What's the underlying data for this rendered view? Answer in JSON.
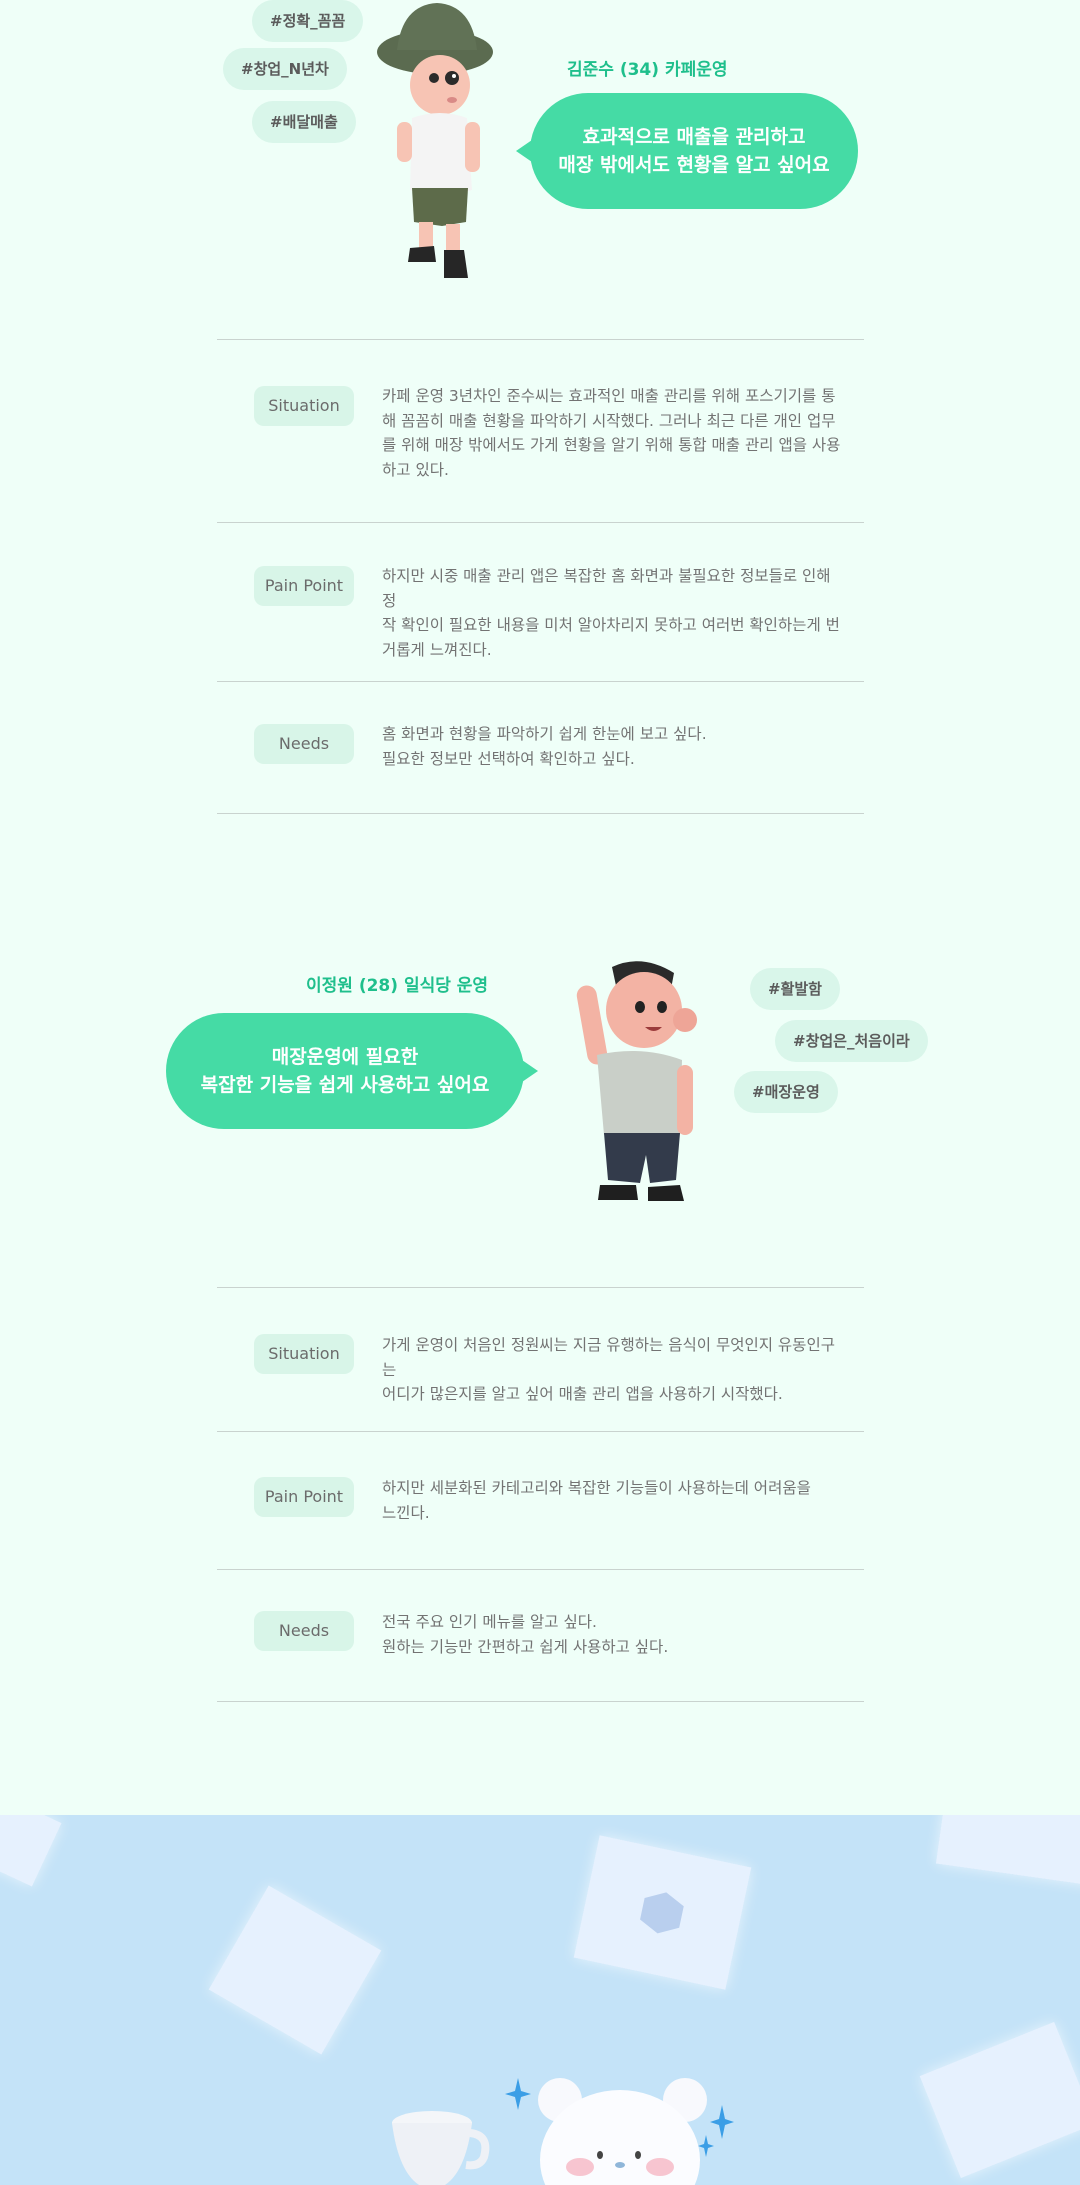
{
  "persona1": {
    "name": "김준수 (34) 카페운영",
    "tags": [
      "#정확_꼼꼼",
      "#창업_N년차",
      "#배달매출"
    ],
    "quote": [
      "효과적으로 매출을 관리하고",
      "매장 밖에서도 현황을 알고 싶어요"
    ],
    "rows": [
      {
        "label": "Situation",
        "text": [
          "카페 운영 3년차인 준수씨는 효과적인 매출 관리를 위해 포스기기를 통",
          "해 꼼꼼히 매출 현황을 파악하기 시작했다. 그러나 최근 다른 개인 업무",
          "를 위해 매장 밖에서도 가게 현황을 알기 위해 통합 매출 관리 앱을 사용",
          "하고 있다."
        ]
      },
      {
        "label": "Pain Point",
        "text": [
          "하지만 시중 매출 관리 앱은 복잡한 홈 화면과 불필요한 정보들로 인해 정",
          "작 확인이 필요한 내용을 미처 알아차리지 못하고 여러번 확인하는게 번",
          "거롭게 느껴진다."
        ]
      },
      {
        "label": "Needs",
        "text": [
          "홈 화면과 현황을 파악하기 쉽게 한눈에 보고 싶다.",
          "필요한 정보만 선택하여 확인하고 싶다."
        ]
      }
    ]
  },
  "persona2": {
    "name": "이정원 (28) 일식당 운영",
    "tags": [
      "#활발함",
      "#창업은_처음이라",
      "#매장운영"
    ],
    "quote": [
      "매장운영에 필요한",
      "복잡한 기능을 쉽게 사용하고 싶어요"
    ],
    "rows": [
      {
        "label": "Situation",
        "text": [
          "가게 운영이 처음인 정원씨는 지금 유행하는 음식이 무엇인지 유동인구는",
          "어디가 많은지를 알고 싶어 매출 관리 앱을 사용하기 시작했다."
        ]
      },
      {
        "label": "Pain Point",
        "text": [
          "하지만 세분화된 카테고리와 복잡한 기능들이 사용하는데 어려움을",
          "느낀다."
        ]
      },
      {
        "label": "Needs",
        "text": [
          "전국 주요 인기 메뉴를 알고 싶다.",
          "원하는 기능만 간편하고 쉽게 사용하고 싶다."
        ]
      }
    ]
  },
  "colors": {
    "background": "#effff8",
    "accent": "#45dba5",
    "accent_text": "#1fbf8c",
    "tag_bg": "#d9f6ea",
    "bottom_bg": "#c4e3f8"
  },
  "icons": [
    "character-hat-icon",
    "character-waving-icon",
    "bear-mascot-icon",
    "sparkle-icon",
    "cup-icon"
  ]
}
